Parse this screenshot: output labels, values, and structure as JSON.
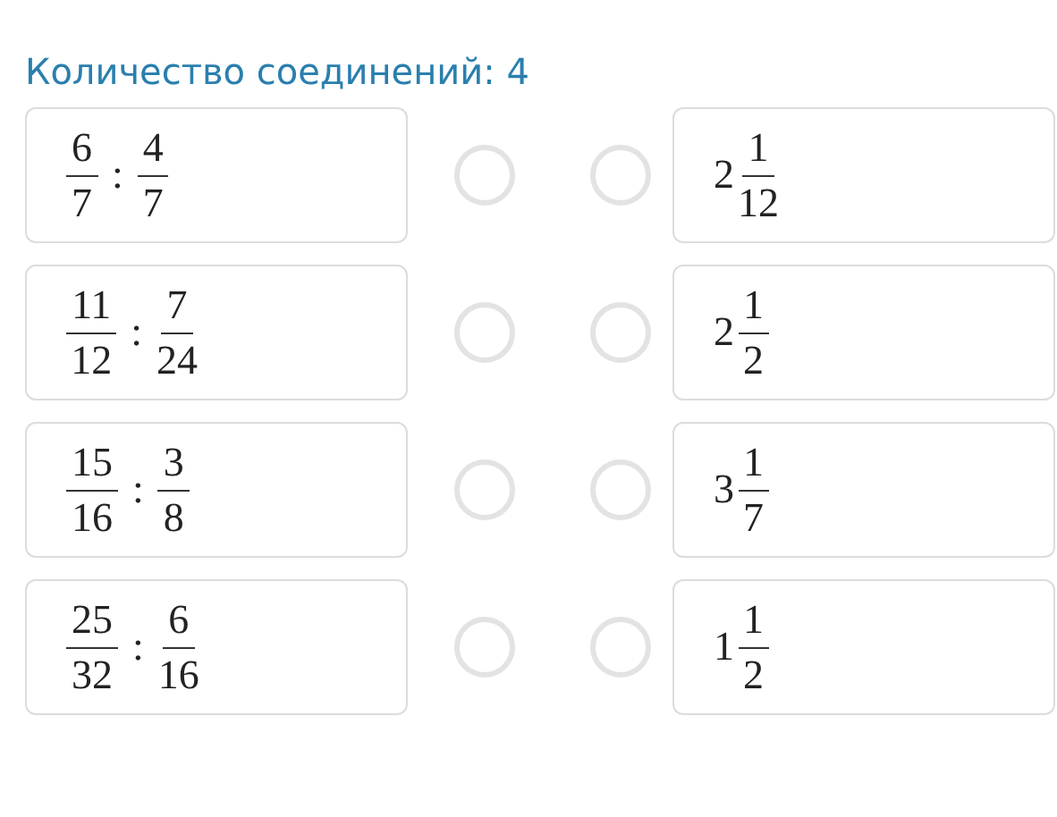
{
  "title": "Количество соединений: 4",
  "rows": [
    {
      "left": {
        "first": {
          "num": "6",
          "den": "7"
        },
        "operator": ":",
        "second": {
          "num": "4",
          "den": "7"
        }
      },
      "left_handle": {
        "selected": false
      },
      "right_handle": {
        "selected": false
      },
      "right": {
        "whole": "2",
        "num": "1",
        "den": "12"
      }
    },
    {
      "left": {
        "first": {
          "num": "11",
          "den": "12"
        },
        "operator": ":",
        "second": {
          "num": "7",
          "den": "24"
        }
      },
      "left_handle": {
        "selected": false
      },
      "right_handle": {
        "selected": false
      },
      "right": {
        "whole": "2",
        "num": "1",
        "den": "2"
      }
    },
    {
      "left": {
        "first": {
          "num": "15",
          "den": "16"
        },
        "operator": ":",
        "second": {
          "num": "3",
          "den": "8"
        }
      },
      "left_handle": {
        "selected": false
      },
      "right_handle": {
        "selected": false
      },
      "right": {
        "whole": "3",
        "num": "1",
        "den": "7"
      }
    },
    {
      "left": {
        "first": {
          "num": "25",
          "den": "32"
        },
        "operator": ":",
        "second": {
          "num": "6",
          "den": "16"
        }
      },
      "left_handle": {
        "selected": false
      },
      "right_handle": {
        "selected": false
      },
      "right": {
        "whole": "1",
        "num": "1",
        "den": "2"
      }
    }
  ]
}
